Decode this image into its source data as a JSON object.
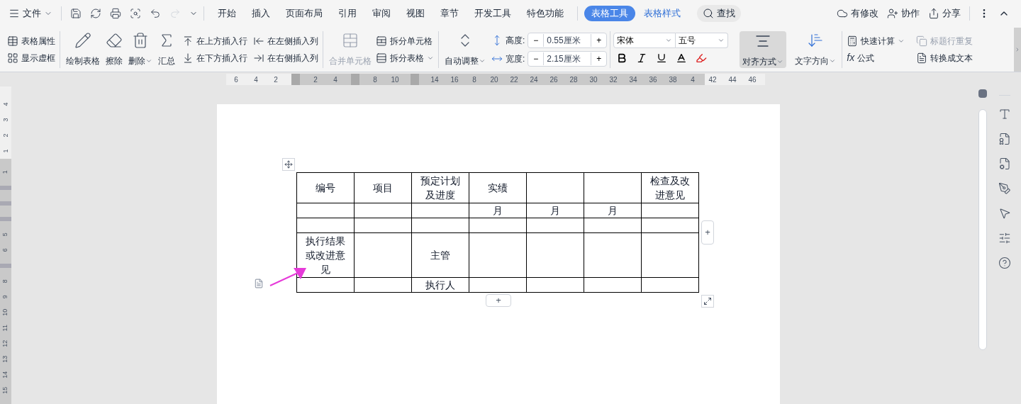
{
  "menu": {
    "label": "文件"
  },
  "tabs": [
    {
      "label": "开始",
      "selected": false,
      "kind": "normal"
    },
    {
      "label": "插入",
      "selected": false,
      "kind": "normal"
    },
    {
      "label": "页面布局",
      "selected": false,
      "kind": "normal"
    },
    {
      "label": "引用",
      "selected": false,
      "kind": "normal"
    },
    {
      "label": "审阅",
      "selected": false,
      "kind": "normal"
    },
    {
      "label": "视图",
      "selected": false,
      "kind": "normal"
    },
    {
      "label": "章节",
      "selected": false,
      "kind": "normal"
    },
    {
      "label": "开发工具",
      "selected": false,
      "kind": "normal"
    },
    {
      "label": "特色功能",
      "selected": false,
      "kind": "normal"
    },
    {
      "label": "表格工具",
      "selected": true,
      "kind": "context"
    },
    {
      "label": "表格样式",
      "selected": false,
      "kind": "context"
    }
  ],
  "search": {
    "label": "查找"
  },
  "top_actions": [
    {
      "label": "有修改",
      "kind": "cloud"
    },
    {
      "label": "协作",
      "kind": "people"
    },
    {
      "label": "分享",
      "kind": "share"
    }
  ],
  "ribbon": {
    "table_props": [
      {
        "label": "表格属性",
        "kind": "props"
      },
      {
        "label": "显示虚框",
        "kind": "grid"
      }
    ],
    "draw_tools": [
      {
        "label": "绘制表格",
        "kind": "draw",
        "dropdown": false
      },
      {
        "label": "擦除",
        "kind": "erase",
        "dropdown": false
      },
      {
        "label": "删除",
        "kind": "delete",
        "dropdown": true
      },
      {
        "label": "汇总",
        "kind": "sum",
        "dropdown": false
      }
    ],
    "insert": [
      {
        "label": "在上方插入行",
        "kind": "row-above"
      },
      {
        "label": "在下方插入行",
        "kind": "row-below"
      },
      {
        "label": "在左侧插入列",
        "kind": "col-left"
      },
      {
        "label": "在右侧插入列",
        "kind": "col-right"
      }
    ],
    "merge": {
      "label": "合并单元格",
      "disabled": true
    },
    "split": [
      {
        "label": "拆分单元格",
        "dropdown": false
      },
      {
        "label": "拆分表格",
        "dropdown": true
      }
    ],
    "autofit": {
      "label": "自动调整",
      "dropdown": true
    },
    "size_fields": [
      {
        "label": "高度:",
        "value": "0.55厘米",
        "minus": "−",
        "plus": "+"
      },
      {
        "label": "宽度:",
        "value": "2.15厘米",
        "minus": "−",
        "plus": "+"
      }
    ],
    "font": {
      "family": "宋体",
      "size": "五号"
    },
    "align": {
      "label": "对齐方式",
      "selected": true,
      "dropdown": true
    },
    "text_direction": {
      "label": "文字方向",
      "dropdown": true
    },
    "formula_tools": [
      {
        "label": "快速计算",
        "kind": "calc",
        "disabled": false,
        "dropdown": true
      },
      {
        "label": "标题行重复",
        "kind": "repeat",
        "disabled": true,
        "dropdown": false
      },
      {
        "label": "公式",
        "kind": "fx",
        "icon_text": "fx",
        "disabled": false,
        "dropdown": false
      },
      {
        "label": "转换成文本",
        "kind": "convert",
        "disabled": false,
        "dropdown": false
      }
    ]
  },
  "ruler": {
    "segments": [
      {
        "kind": "label",
        "text": "6"
      },
      {
        "kind": "label",
        "text": "4"
      },
      {
        "kind": "label",
        "text": "2"
      },
      {
        "kind": "marker"
      },
      {
        "kind": "label",
        "text": "2"
      },
      {
        "kind": "label",
        "text": "4"
      },
      {
        "kind": "marker"
      },
      {
        "kind": "label",
        "text": "8"
      },
      {
        "kind": "label",
        "text": "10"
      },
      {
        "kind": "marker"
      },
      {
        "kind": "label",
        "text": "14"
      },
      {
        "kind": "label",
        "text": "16"
      },
      {
        "kind": "label",
        "text": "8"
      },
      {
        "kind": "label",
        "text": "20"
      },
      {
        "kind": "label",
        "text": "22"
      },
      {
        "kind": "label",
        "text": "24"
      },
      {
        "kind": "label",
        "text": "26"
      },
      {
        "kind": "label",
        "text": "28"
      },
      {
        "kind": "label",
        "text": "30"
      },
      {
        "kind": "label",
        "text": "32"
      },
      {
        "kind": "label",
        "text": "34"
      },
      {
        "kind": "label",
        "text": "36"
      },
      {
        "kind": "label",
        "text": "38"
      },
      {
        "kind": "label",
        "text": "4"
      },
      {
        "kind": "label",
        "text": "42"
      },
      {
        "kind": "label",
        "text": "44"
      },
      {
        "kind": "label",
        "text": "46"
      }
    ]
  },
  "vertical_ruler": {
    "top_labels": [
      "4",
      "3",
      "2",
      "1"
    ],
    "segments": [
      {
        "kind": "label",
        "text": "1"
      },
      {
        "kind": "marker"
      },
      {
        "kind": "marker"
      },
      {
        "kind": "marker"
      },
      {
        "kind": "label",
        "text": "5"
      },
      {
        "kind": "label",
        "text": "6"
      },
      {
        "kind": "marker"
      },
      {
        "kind": "label",
        "text": "8"
      },
      {
        "kind": "label",
        "text": "9"
      },
      {
        "kind": "label",
        "text": "10"
      },
      {
        "kind": "label",
        "text": "11"
      },
      {
        "kind": "label",
        "text": "12"
      },
      {
        "kind": "label",
        "text": "13"
      },
      {
        "kind": "label",
        "text": "14"
      },
      {
        "kind": "label",
        "text": "15"
      }
    ]
  },
  "table": {
    "rows": [
      {
        "cells": [
          "编号",
          "项目",
          "预定计划及进度",
          "实绩",
          null,
          null,
          "检查及改进意见"
        ]
      },
      {
        "cells": [
          null,
          null,
          null,
          "月",
          "月",
          "月",
          null
        ]
      },
      {
        "cells": [
          null,
          null,
          null,
          null,
          null,
          null,
          null
        ]
      },
      {
        "cells": [
          "执行结果或改进意见",
          null,
          "主管",
          null,
          null,
          null,
          null
        ]
      },
      {
        "cells": [
          null,
          null,
          "执行人",
          null,
          null,
          null,
          null
        ]
      }
    ]
  },
  "table_controls": {
    "add_row": "+",
    "add_column": "+"
  }
}
